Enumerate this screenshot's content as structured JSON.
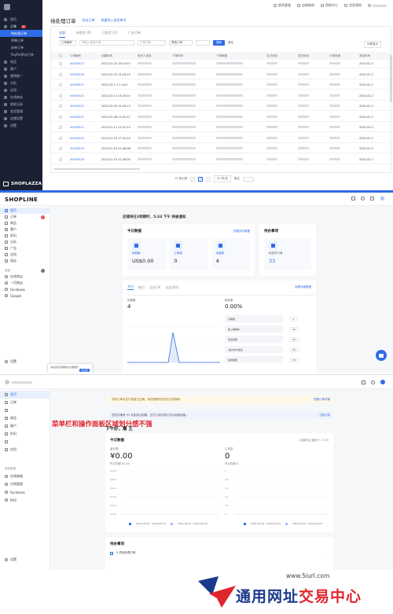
{
  "panel1": {
    "sidebar": {
      "items": [
        {
          "label": "首页",
          "type": "nav"
        },
        {
          "label": "订单",
          "type": "open",
          "badge": "9"
        },
        {
          "label": "待处理订单",
          "type": "sub-sel"
        },
        {
          "label": "草稿订单",
          "type": "sub"
        },
        {
          "label": "弃单订单",
          "type": "sub"
        },
        {
          "label": "PayPal争议订单",
          "type": "sub"
        },
        {
          "label": "商品",
          "type": "nav"
        },
        {
          "label": "客户",
          "type": "nav"
        },
        {
          "label": "营销推广",
          "type": "nav"
        },
        {
          "label": "分析",
          "type": "nav"
        },
        {
          "label": "应用",
          "type": "nav"
        },
        {
          "label": "在线商店",
          "type": "nav"
        },
        {
          "label": "收款记录",
          "type": "nav"
        },
        {
          "label": "发货管理",
          "type": "nav"
        },
        {
          "label": "店铺设置",
          "type": "nav"
        },
        {
          "label": "设置",
          "type": "nav"
        }
      ],
      "brand": "SHOPLAZZA"
    },
    "topbar": [
      "联系客服",
      "店铺装修",
      "帮助中心",
      "消息通知"
    ],
    "title": "待处理订单",
    "title_links": [
      "导出订单",
      "批量导入发货单号"
    ],
    "tabs": [
      "全部",
      "待发货 (9)",
      "已发货 (3)",
      "广告订单"
    ],
    "filter": {
      "select": "订单编号",
      "search_placeholder": "请输入搜索订单",
      "date_placeholder": "下单日期",
      "more": "筛选订单",
      "btn": "搜索",
      "clear": "清空",
      "right": "列表显示"
    },
    "columns": [
      "订单编号",
      "创建时间",
      "收货人信息",
      "下单时间",
      "下单邮箱",
      "支付状态",
      "发货状态",
      "订单来源",
      "添加时间"
    ],
    "rows": [
      {
        "id": "00000027",
        "time": "2022.02.23 18:14:57"
      },
      {
        "id": "00000026",
        "time": "2022.02.23 15:16:19"
      },
      {
        "id": "00000025",
        "time": "2022.02.1 1 1 4:01"
      },
      {
        "id": "00000024",
        "time": "2022.02.14 15:16:24"
      },
      {
        "id": "00000023",
        "time": "2022.02.09 15:18:13"
      },
      {
        "id": "00000022",
        "time": "2022.02.08 21:02:57"
      },
      {
        "id": "00000021",
        "time": "2022.01.11 11:47:10"
      },
      {
        "id": "00000020",
        "time": "2022.01.10 17:34:25"
      },
      {
        "id": "00000019",
        "time": "2022.01.10 22:46:06"
      },
      {
        "id": "00000018",
        "time": "2022.01.10 22:26:00"
      }
    ],
    "row_last_col": "2022.02.2",
    "pager": {
      "total": "15 条记录",
      "page": "1",
      "size": "20 条/页",
      "goto": "跳至"
    }
  },
  "panel2": {
    "logo": "SHOPLINE",
    "avatar": "B",
    "sidebar": [
      {
        "label": "首页",
        "sel": true
      },
      {
        "label": "订单",
        "badge": "1"
      },
      {
        "label": "商品"
      },
      {
        "label": "客户"
      },
      {
        "label": "折扣"
      },
      {
        "label": "分析"
      },
      {
        "label": "广告"
      },
      {
        "label": "应用"
      },
      {
        "label": "网店"
      }
    ],
    "sales_channels_label": "渠道",
    "channels": [
      "在线商店",
      "一页商店",
      "Facebook",
      "Google"
    ],
    "settings": "设置",
    "greeting": "店铺将在3到期时，5:24 下午 将被通知",
    "today": {
      "title": "今日数据",
      "link": "查看实时数据",
      "stats": [
        {
          "label": "销售额",
          "value": "US$0.00"
        },
        {
          "label": "订单量",
          "value": "0"
        },
        {
          "label": "访客数",
          "value": "4"
        }
      ]
    },
    "todo": {
      "title": "待办事项",
      "label": "待发货订单",
      "value": "33"
    },
    "chart": {
      "tabs": [
        "今日",
        "昨日",
        "过去7天",
        "过去30天"
      ],
      "link": "查看详细数据",
      "metric_label": "访客数",
      "metric_value": "4",
      "conv_label": "转化率",
      "conv_value": "0.00%",
      "funnel": [
        {
          "label": "访客数",
          "value": "4"
        },
        {
          "label": "加入购物车",
          "value": "0%"
        },
        {
          "label": "到达结账",
          "value": "0%"
        },
        {
          "label": "·提交支付信息",
          "value": "0%"
        },
        {
          "label": "完成结账",
          "value": "0%"
        }
      ]
    },
    "tip": "请先完善店铺信息以便展示",
    "tip_btn": "去设置"
  },
  "panel3": {
    "sidebar": [
      "首页",
      "订单",
      "",
      "商品",
      "客户",
      "折扣",
      "",
      "应用"
    ],
    "sales_channels_label": "销售渠道",
    "channels": [
      "在线商城",
      "分销管理",
      "Facebook",
      "POS"
    ],
    "settings": "设置",
    "banner1": "您有订单未支付或者已过期，请在限期内完成支付或移除",
    "banner1_link": "查看订单详情",
    "banner2": "您的店铺有 91 天免费试用期，正在订阅付费计划以继续经营...",
    "banner2_link": "立即订阅",
    "annotation": "菜单栏和操作面板区域划分感不强",
    "greeting": "下午好，屠 王",
    "card": {
      "title": "今日数据",
      "link": "店铺时区·更新于 17:09",
      "left": {
        "label": "营业额",
        "value": "¥0.00",
        "sub": "昨日同期 ¥0.00"
      },
      "right": {
        "label": "订单量",
        "value": "0",
        "sub": "昨日同期 0"
      },
      "yticks_left": [
        "¥0.00",
        "¥0.00",
        "¥0.00",
        "¥0.00",
        "¥0.00",
        "¥0.00"
      ],
      "yticks_right": [
        "1",
        "0.8",
        "0.6",
        "0.4",
        "0.2",
        "0"
      ],
      "legend": [
        "2022-03-24 - 2022-03-24",
        "2022-03-23 - 2022-03-23"
      ]
    },
    "todo": {
      "title": "待办事项",
      "item": "5 项待处理订单"
    }
  },
  "watermark": {
    "url": "www.5iurl.com",
    "cn_a": "通用网址",
    "cn_b": "交易中心"
  },
  "colors": {
    "primary": "#2e6be6",
    "sidebar_dark": "#1b2133",
    "annotation_red": "#e0262d"
  }
}
